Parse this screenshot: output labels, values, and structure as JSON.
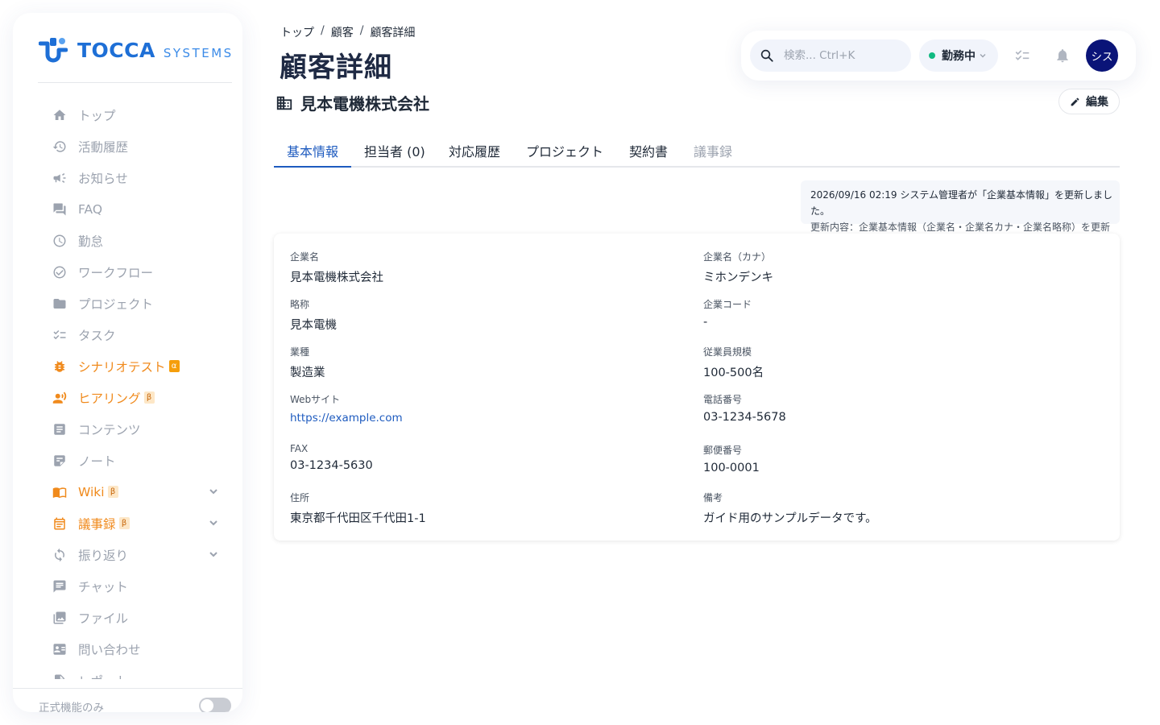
{
  "sidebar": {
    "brand": {
      "name": "TOCCA",
      "sub": "SYSTEMS"
    },
    "items": [
      {
        "label": "トップ",
        "icon": "home-icon"
      },
      {
        "label": "活動履歴",
        "icon": "history-icon"
      },
      {
        "label": "お知らせ",
        "icon": "megaphone-icon"
      },
      {
        "label": "FAQ",
        "icon": "forum-icon"
      },
      {
        "label": "勤怠",
        "icon": "clock-icon"
      },
      {
        "label": "ワークフロー",
        "icon": "check-circle-icon"
      },
      {
        "label": "プロジェクト",
        "icon": "folder-icon"
      },
      {
        "label": "タスク",
        "icon": "checklist-icon"
      },
      {
        "label": "シナリオテスト",
        "icon": "bug-icon",
        "badge": "α"
      },
      {
        "label": "ヒアリング",
        "icon": "voice-person-icon",
        "badge": "β"
      },
      {
        "label": "コンテンツ",
        "icon": "article-icon"
      },
      {
        "label": "ノート",
        "icon": "note-icon"
      },
      {
        "label": "Wiki",
        "icon": "book-icon",
        "badge": "β"
      },
      {
        "label": "議事録",
        "icon": "calendar-icon",
        "badge": "β"
      },
      {
        "label": "振り返り",
        "icon": "sync-icon"
      },
      {
        "label": "チャット",
        "icon": "chat-icon"
      },
      {
        "label": "ファイル",
        "icon": "photo-library-icon"
      },
      {
        "label": "問い合わせ",
        "icon": "contact-card-icon"
      },
      {
        "label": "レポート",
        "icon": "report-icon"
      }
    ],
    "footer": {
      "label": "正式機能のみ"
    }
  },
  "header": {
    "breadcrumb": [
      "トップ",
      "顧客",
      "顧客詳細"
    ],
    "separator": "/",
    "title": "顧客詳細",
    "search_placeholder": "検索... Ctrl+K",
    "status": "勤務中",
    "avatar": "シス"
  },
  "company": {
    "name": "見本電機株式会社",
    "edit_label": "編集"
  },
  "tabs": [
    "基本情報",
    "担当者 (0)",
    "対応履歴",
    "プロジェクト",
    "契約書",
    "議事録"
  ],
  "update_note": {
    "line1": "2026/09/16 02:19 システム管理者が「企業基本情報」を更新しました。",
    "line2": "更新内容：企業基本情報（企業名・企業名カナ・企業名略称）を更新"
  },
  "details": {
    "left": [
      {
        "label": "企業名",
        "value": "見本電機株式会社"
      },
      {
        "label": "略称",
        "value": "見本電機"
      },
      {
        "label": "業種",
        "value": "製造業"
      },
      {
        "label": "Webサイト",
        "value": "https://example.com"
      },
      {
        "label": "FAX",
        "value": "03-1234-5630"
      },
      {
        "label": "住所",
        "value": "東京都千代田区千代田1-1"
      }
    ],
    "right": [
      {
        "label": "企業名（カナ）",
        "value": "ミホンデンキ"
      },
      {
        "label": "企業コード",
        "value": "-"
      },
      {
        "label": "従業員規模",
        "value": "100-500名"
      },
      {
        "label": "電話番号",
        "value": "03-1234-5678"
      },
      {
        "label": "郵便番号",
        "value": "100-0001"
      },
      {
        "label": "備考",
        "value": "ガイド用のサンプルデータです。"
      }
    ]
  },
  "colors": {
    "accent": "#1e5bbf",
    "beta": "#f08a1c",
    "avatar": "#0a1478",
    "online": "#10b981"
  }
}
